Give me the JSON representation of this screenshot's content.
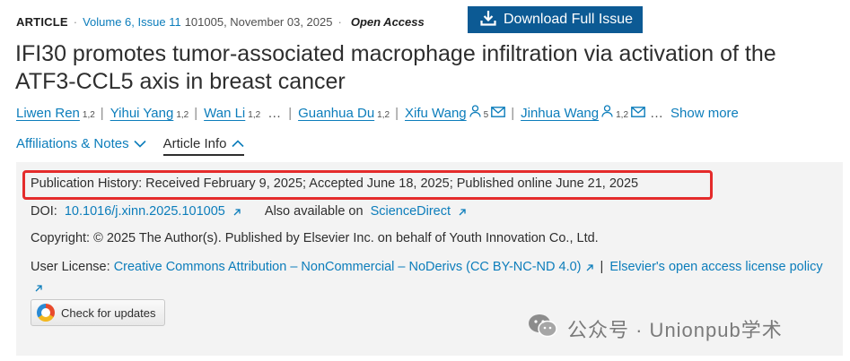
{
  "meta": {
    "type_label": "ARTICLE",
    "volume": "Volume 6, Issue 11",
    "article_no": "101005, November 03, 2025",
    "access": "Open Access"
  },
  "download_button": {
    "label": "Download Full Issue",
    "icon": "download-icon"
  },
  "title": "IFI30 promotes tumor-associated macrophage infiltration via activation of the ATF3-CCL5 axis in breast cancer",
  "authors": [
    {
      "name": "Liwen Ren",
      "sup": "1,2"
    },
    {
      "name": "Yihui Yang",
      "sup": "1,2"
    },
    {
      "name": "Wan Li",
      "sup": "1,2"
    },
    {
      "name": "Guanhua Du",
      "sup": "1,2"
    },
    {
      "name": "Xifu Wang",
      "sup": "5"
    },
    {
      "name": "Jinhua Wang",
      "sup": "1,2"
    }
  ],
  "authors_ellipsis": "…",
  "authors_ellipsis_end": "…",
  "show_more": "Show more",
  "tabs": {
    "affiliations": "Affiliations & Notes",
    "article_info": "Article Info"
  },
  "info": {
    "history": "Publication History:  Received February 9, 2025; Accepted June 18, 2025; Published online June 21, 2025",
    "doi_label": "DOI:",
    "doi": "10.1016/j.xinn.2025.101005",
    "also_label": "Also available on",
    "also_link": "ScienceDirect",
    "copyright": "Copyright: © 2025 The Author(s). Published by Elsevier Inc. on behalf of Youth Innovation Co., Ltd.",
    "license_label": "User License:",
    "license_link": "Creative Commons Attribution – NonCommercial – NoDerivs (CC BY-NC-ND 4.0)",
    "license_sep": "|",
    "policy_link": "Elsevier's open access license policy"
  },
  "updates_button": "Check for updates",
  "watermark": "公众号 · Unionpub学术",
  "colors": {
    "link": "#0c7dbb",
    "button": "#0c5a94",
    "highlight": "#e42b2b",
    "panel": "#f3f3f3"
  }
}
